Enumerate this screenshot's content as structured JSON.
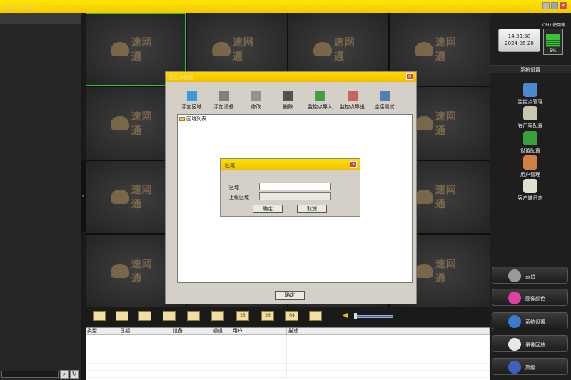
{
  "app": {
    "title": "监控客户端软件"
  },
  "left_panel": {
    "search_placeholder": ""
  },
  "video_grid": {
    "brand": "速网通"
  },
  "toolbar": {
    "buttons": [
      "",
      "",
      "",
      "",
      "",
      "",
      "35",
      "36",
      "64",
      ""
    ]
  },
  "log_table": {
    "headers": [
      "类型",
      "日期",
      "设备",
      "通道",
      "用户",
      "描述"
    ]
  },
  "status": {
    "time": "14:33:58",
    "date": "2024-06-20",
    "cpu_label": "CPU 使用率",
    "cpu_percent": "5%",
    "cpu_level": 0.7
  },
  "sidebar": {
    "section_title": "系统设置",
    "items": [
      {
        "label": "监控点管理",
        "icon": "camera-manage-icon"
      },
      {
        "label": "客户端配置",
        "icon": "client-config-icon"
      },
      {
        "label": "设备配置",
        "icon": "device-config-icon"
      },
      {
        "label": "用户管理",
        "icon": "user-manage-icon"
      },
      {
        "label": "客户端日志",
        "icon": "client-log-icon"
      }
    ],
    "bottom_buttons": [
      {
        "label": "云台",
        "icon": "ptz-icon"
      },
      {
        "label": "图像颜色",
        "icon": "color-icon"
      },
      {
        "label": "系统设置",
        "icon": "settings-icon"
      },
      {
        "label": "录像回放",
        "icon": "playback-icon"
      },
      {
        "label": "高级",
        "icon": "advanced-icon"
      }
    ]
  },
  "dialog_main": {
    "title": "监控点管理",
    "tools": [
      "添加区域",
      "添加设备",
      "修改",
      "删除",
      "监控点导入",
      "监控点导出",
      "连接测试"
    ],
    "tree_root": "区域列表",
    "ok_label": "确定"
  },
  "dialog_area": {
    "title": "区域",
    "area_label": "区域",
    "parent_label": "上级区域",
    "area_value": "",
    "parent_value": "",
    "ok_label": "确定",
    "cancel_label": "取消"
  }
}
